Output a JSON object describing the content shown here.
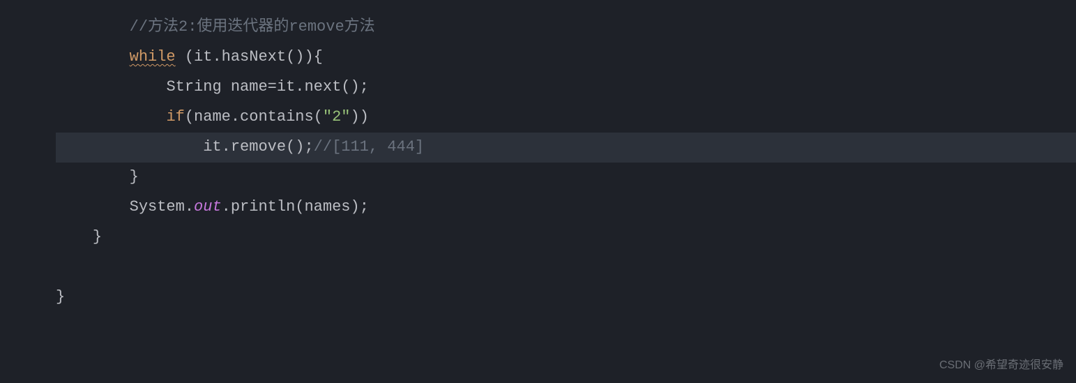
{
  "code": {
    "lines": [
      {
        "indent": "        ",
        "tokens": [
          {
            "cls": "comment",
            "text": "//方法2:使用迭代器的remove方法"
          }
        ],
        "highlighted": false
      },
      {
        "indent": "        ",
        "tokens": [
          {
            "cls": "keyword-while",
            "text": "while"
          },
          {
            "cls": "paren",
            "text": " (it.hasNext()){"
          }
        ],
        "highlighted": false
      },
      {
        "indent": "            ",
        "tokens": [
          {
            "cls": "type",
            "text": "String name=it.next();"
          }
        ],
        "highlighted": false
      },
      {
        "indent": "            ",
        "tokens": [
          {
            "cls": "keyword",
            "text": "if"
          },
          {
            "cls": "paren",
            "text": "(name.contains("
          },
          {
            "cls": "string",
            "text": "\"2\""
          },
          {
            "cls": "paren",
            "text": "))"
          }
        ],
        "highlighted": false
      },
      {
        "indent": "                ",
        "tokens": [
          {
            "cls": "var",
            "text": "it.remove();"
          },
          {
            "cls": "comment",
            "text": "//[111, 444]"
          }
        ],
        "highlighted": true
      },
      {
        "indent": "        ",
        "tokens": [
          {
            "cls": "brace",
            "text": "}"
          }
        ],
        "highlighted": false
      },
      {
        "indent": "        ",
        "tokens": [
          {
            "cls": "var",
            "text": "System."
          },
          {
            "cls": "italic-static",
            "text": "out"
          },
          {
            "cls": "var",
            "text": ".println(names);"
          }
        ],
        "highlighted": false
      },
      {
        "indent": "    ",
        "tokens": [
          {
            "cls": "brace",
            "text": "}"
          }
        ],
        "highlighted": false
      },
      {
        "indent": "",
        "tokens": [],
        "highlighted": false
      },
      {
        "indent": "",
        "tokens": [
          {
            "cls": "brace",
            "text": "}"
          }
        ],
        "highlighted": false
      }
    ]
  },
  "watermark": "CSDN @希望奇迹很安静"
}
